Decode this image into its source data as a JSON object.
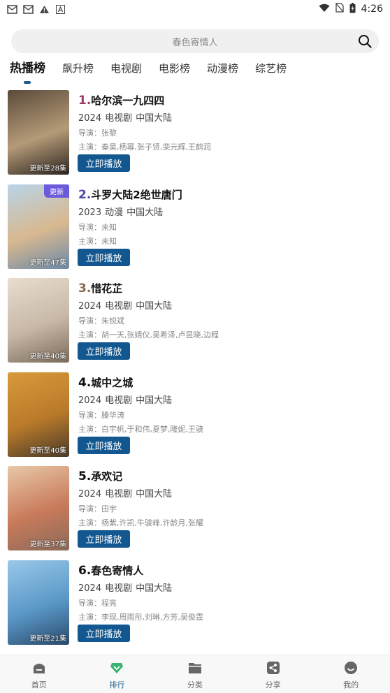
{
  "status_bar": {
    "time": "4:26"
  },
  "search": {
    "text": "春色寄情人"
  },
  "tabs": [
    {
      "label": "热播榜"
    },
    {
      "label": "飙升榜"
    },
    {
      "label": "电视剧"
    },
    {
      "label": "电影榜"
    },
    {
      "label": "动漫榜"
    },
    {
      "label": "综艺榜"
    }
  ],
  "items": [
    {
      "rank": "1.",
      "rank_color": "#9b3a6b",
      "title": "哈尔滨一九四四",
      "year": "2024",
      "type": "电视剧",
      "region": "中国大陆",
      "director": "导演：张黎",
      "cast": "主演：秦昊,杨幂,张子贤,栾元辉,王鹤润",
      "update": "更新至28集",
      "badge": "",
      "play": "立即播放",
      "poster_colors": [
        "#5b4a3a",
        "#b49a78",
        "#2c2420"
      ]
    },
    {
      "rank": "2.",
      "rank_color": "#4a4aa8",
      "title": "斗罗大陆2绝世唐门",
      "year": "2023",
      "type": "动漫",
      "region": "中国大陆",
      "director": "导演：未知",
      "cast": "主演：未知",
      "update": "更新至47集",
      "badge": "更新",
      "play": "立即播放",
      "poster_colors": [
        "#b8d4e8",
        "#d8b890",
        "#6b8aa8"
      ]
    },
    {
      "rank": "3.",
      "rank_color": "#8a6a4a",
      "title": "惜花芷",
      "year": "2024",
      "type": "电视剧",
      "region": "中国大陆",
      "director": "导演：朱锐斌",
      "cast": "主演：胡一天,张婧仪,吴希泽,卢昱晓,边程",
      "update": "更新至40集",
      "badge": "",
      "play": "立即播放",
      "poster_colors": [
        "#e8ddd0",
        "#c8b8a8",
        "#7a6a5a"
      ]
    },
    {
      "rank": "4.",
      "rank_color": "#111111",
      "title": "城中之城",
      "year": "2024",
      "type": "电视剧",
      "region": "中国大陆",
      "director": "导演：滕华涛",
      "cast": "主演：白宇帆,于和伟,夏梦,隆妮,王骁",
      "update": "更新至40集",
      "badge": "",
      "play": "立即播放",
      "poster_colors": [
        "#d89a3a",
        "#b87a2a",
        "#4a3a2a"
      ]
    },
    {
      "rank": "5.",
      "rank_color": "#111111",
      "title": "承欢记",
      "year": "2024",
      "type": "电视剧",
      "region": "中国大陆",
      "director": "导演：田宇",
      "cast": "主演：杨紫,许凯,牛骏峰,许龄月,张耀",
      "update": "更新至37集",
      "badge": "",
      "play": "立即播放",
      "poster_colors": [
        "#e8c8a8",
        "#c87a5a",
        "#8a6a5a"
      ]
    },
    {
      "rank": "6.",
      "rank_color": "#111111",
      "title": "春色寄情人",
      "year": "2024",
      "type": "电视剧",
      "region": "中国大陆",
      "director": "导演：程亮",
      "cast": "主演：李现,周雨彤,刘琳,方芳,吴俊霆",
      "update": "更新至21集",
      "badge": "",
      "play": "立即播放",
      "poster_colors": [
        "#9ac8e8",
        "#5a98c8",
        "#2a4a6a"
      ]
    }
  ],
  "bottom_nav": [
    {
      "label": "首页",
      "icon": "home-icon"
    },
    {
      "label": "排行",
      "icon": "ranking-icon"
    },
    {
      "label": "分类",
      "icon": "folder-icon"
    },
    {
      "label": "分享",
      "icon": "share-icon"
    },
    {
      "label": "我的",
      "icon": "profile-icon"
    }
  ],
  "colors": {
    "accent": "#12578f",
    "active_nav": "#3cb371"
  }
}
